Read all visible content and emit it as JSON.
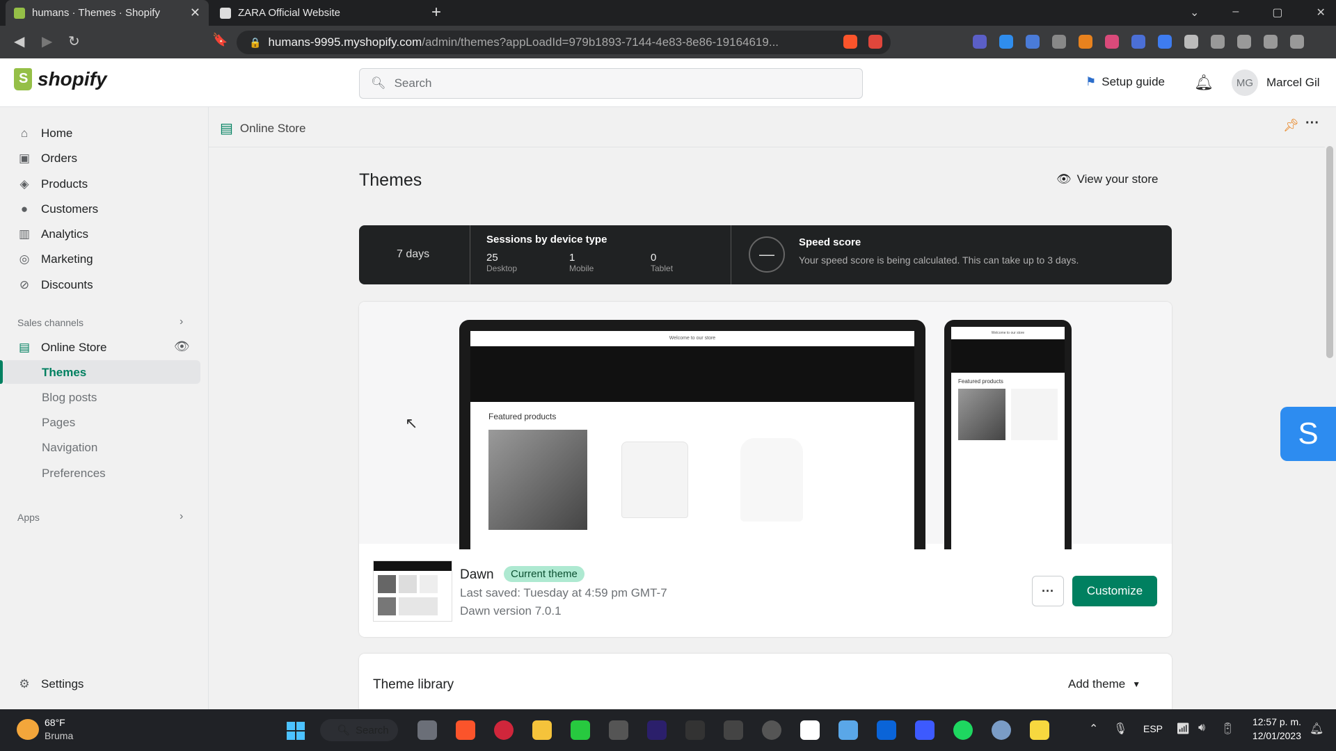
{
  "browser": {
    "tabs": [
      {
        "title": "humans · Themes · Shopify",
        "fav_color": "#95bf47"
      },
      {
        "title": "ZARA Official Website",
        "fav_color": "#dddddd"
      }
    ],
    "new_tab": "+",
    "url_host": "humans-9995.myshopify.com",
    "url_path": "/admin/themes?appLoadId=979b1893-7144-4e83-8e86-19164619...",
    "window_controls": [
      "⌄",
      "–",
      "▢",
      "✕"
    ]
  },
  "header": {
    "brand": "shopify",
    "search_placeholder": "Search",
    "setup_guide": "Setup guide",
    "avatar_initials": "MG",
    "user_name": "Marcel Gil"
  },
  "sidebar": {
    "items": [
      {
        "label": "Home",
        "icon": "home-icon",
        "glyph": "⌂"
      },
      {
        "label": "Orders",
        "icon": "orders-icon",
        "glyph": "▣"
      },
      {
        "label": "Products",
        "icon": "tag-icon",
        "glyph": "◈"
      },
      {
        "label": "Customers",
        "icon": "person-icon",
        "glyph": "●"
      },
      {
        "label": "Analytics",
        "icon": "bars-icon",
        "glyph": "▥"
      },
      {
        "label": "Marketing",
        "icon": "target-icon",
        "glyph": "◎"
      },
      {
        "label": "Discounts",
        "icon": "discount-icon",
        "glyph": "⊘"
      }
    ],
    "sales_channels": "Sales channels",
    "online_store": "Online Store",
    "sub_items": [
      "Themes",
      "Blog posts",
      "Pages",
      "Navigation",
      "Preferences"
    ],
    "apps": "Apps",
    "settings": "Settings"
  },
  "main": {
    "breadcrumb": "Online Store",
    "title": "Themes",
    "view_store": "View your store",
    "stats": {
      "period": "7 days",
      "sessions_title": "Sessions by device type",
      "devices": [
        {
          "value": "25",
          "label": "Desktop"
        },
        {
          "value": "1",
          "label": "Mobile"
        },
        {
          "value": "0",
          "label": "Tablet"
        }
      ],
      "speed_title": "Speed score",
      "speed_text": "Your speed score is being calculated. This can take up to 3 days."
    },
    "preview": {
      "featured": "Featured products",
      "announcement": "Welcome to our store"
    },
    "current_theme": {
      "name": "Dawn",
      "badge": "Current theme",
      "last_saved": "Last saved: Tuesday at 4:59 pm GMT-7",
      "version": "Dawn version 7.0.1",
      "more": "···",
      "customize": "Customize"
    },
    "library": {
      "title": "Theme library",
      "add_theme": "Add theme"
    }
  },
  "floating": {
    "letter": "S"
  },
  "taskbar": {
    "weather_temp": "68°F",
    "weather_desc": "Bruma",
    "search": "Search",
    "lang": "ESP",
    "time": "12:57 p. m.",
    "date": "12/01/2023"
  },
  "colors": {
    "accent": "#008060",
    "badge_bg": "#aee9d1",
    "stats_bg": "#202223"
  }
}
